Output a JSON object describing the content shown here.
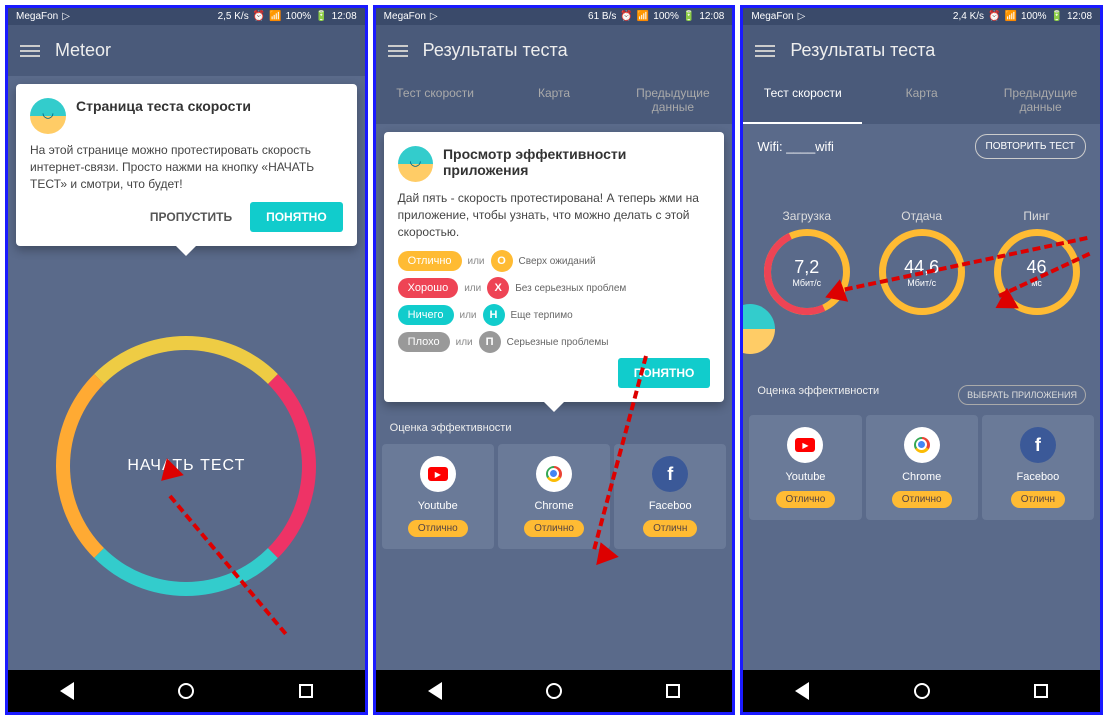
{
  "statusbar": {
    "carrier": "MegaFon",
    "speed1": "2,5 K/s",
    "speed2": "61 B/s",
    "speed3": "2,4 K/s",
    "battery": "100%",
    "time": "12:08"
  },
  "screen1": {
    "title": "Meteor",
    "popup": {
      "heading": "Страница теста скорости",
      "body": "На этой странице можно протестировать скорость интернет-связи. Просто нажми на кнопку «НАЧАТЬ ТЕСТ» и смотри, что будет!",
      "skip": "ПРОПУСТИТЬ",
      "ok": "ПОНЯТНО"
    },
    "startTest": "НАЧАТЬ ТЕСТ"
  },
  "screen2": {
    "title": "Результаты теста",
    "tabs": {
      "speed": "Тест скорости",
      "map": "Карта",
      "prev": "Предыдущие данные"
    },
    "popup": {
      "heading": "Просмотр эффективности приложения",
      "body": "Дай пять - скорость протестирована! А теперь жми на приложение, чтобы узнать, что можно делать с этой скоростью.",
      "ok": "ПОНЯТНО"
    },
    "legend": {
      "or": "или",
      "excellent": "Отлично",
      "excellentDesc": "Сверх ожиданий",
      "excellentL": "О",
      "good": "Хорошо",
      "goodDesc": "Без серьезных проблем",
      "goodL": "Х",
      "ok": "Ничего",
      "okDesc": "Еще терпимо",
      "okL": "Н",
      "bad": "Плохо",
      "badDesc": "Серьезные проблемы",
      "badL": "П"
    },
    "effLabel": "Оценка эффективности",
    "chooseApps": "ВЫБРАТЬ ПРИЛОЖЕНИЯ"
  },
  "screen3": {
    "title": "Результаты теста",
    "tabs": {
      "speed": "Тест скорости",
      "map": "Карта",
      "prev": "Предыдущие данные"
    },
    "wifiLabel": "Wifi:",
    "wifiName": "____wifi",
    "repeat": "ПОВТОРИТЬ ТЕСТ",
    "metrics": {
      "download": {
        "label": "Загрузка",
        "value": "7,2",
        "unit": "Мбит/с"
      },
      "upload": {
        "label": "Отдача",
        "value": "44,6",
        "unit": "Мбит/с"
      },
      "ping": {
        "label": "Пинг",
        "value": "46",
        "unit": "мс"
      }
    },
    "effLabel": "Оценка эффективности",
    "chooseApps": "ВЫБРАТЬ ПРИЛОЖЕНИЯ"
  },
  "apps": {
    "youtube": {
      "name": "Youtube",
      "rating": "Отлично"
    },
    "chrome": {
      "name": "Chrome",
      "rating": "Отлично"
    },
    "facebook": {
      "name": "Faceboo",
      "rating": "Отличн"
    }
  }
}
